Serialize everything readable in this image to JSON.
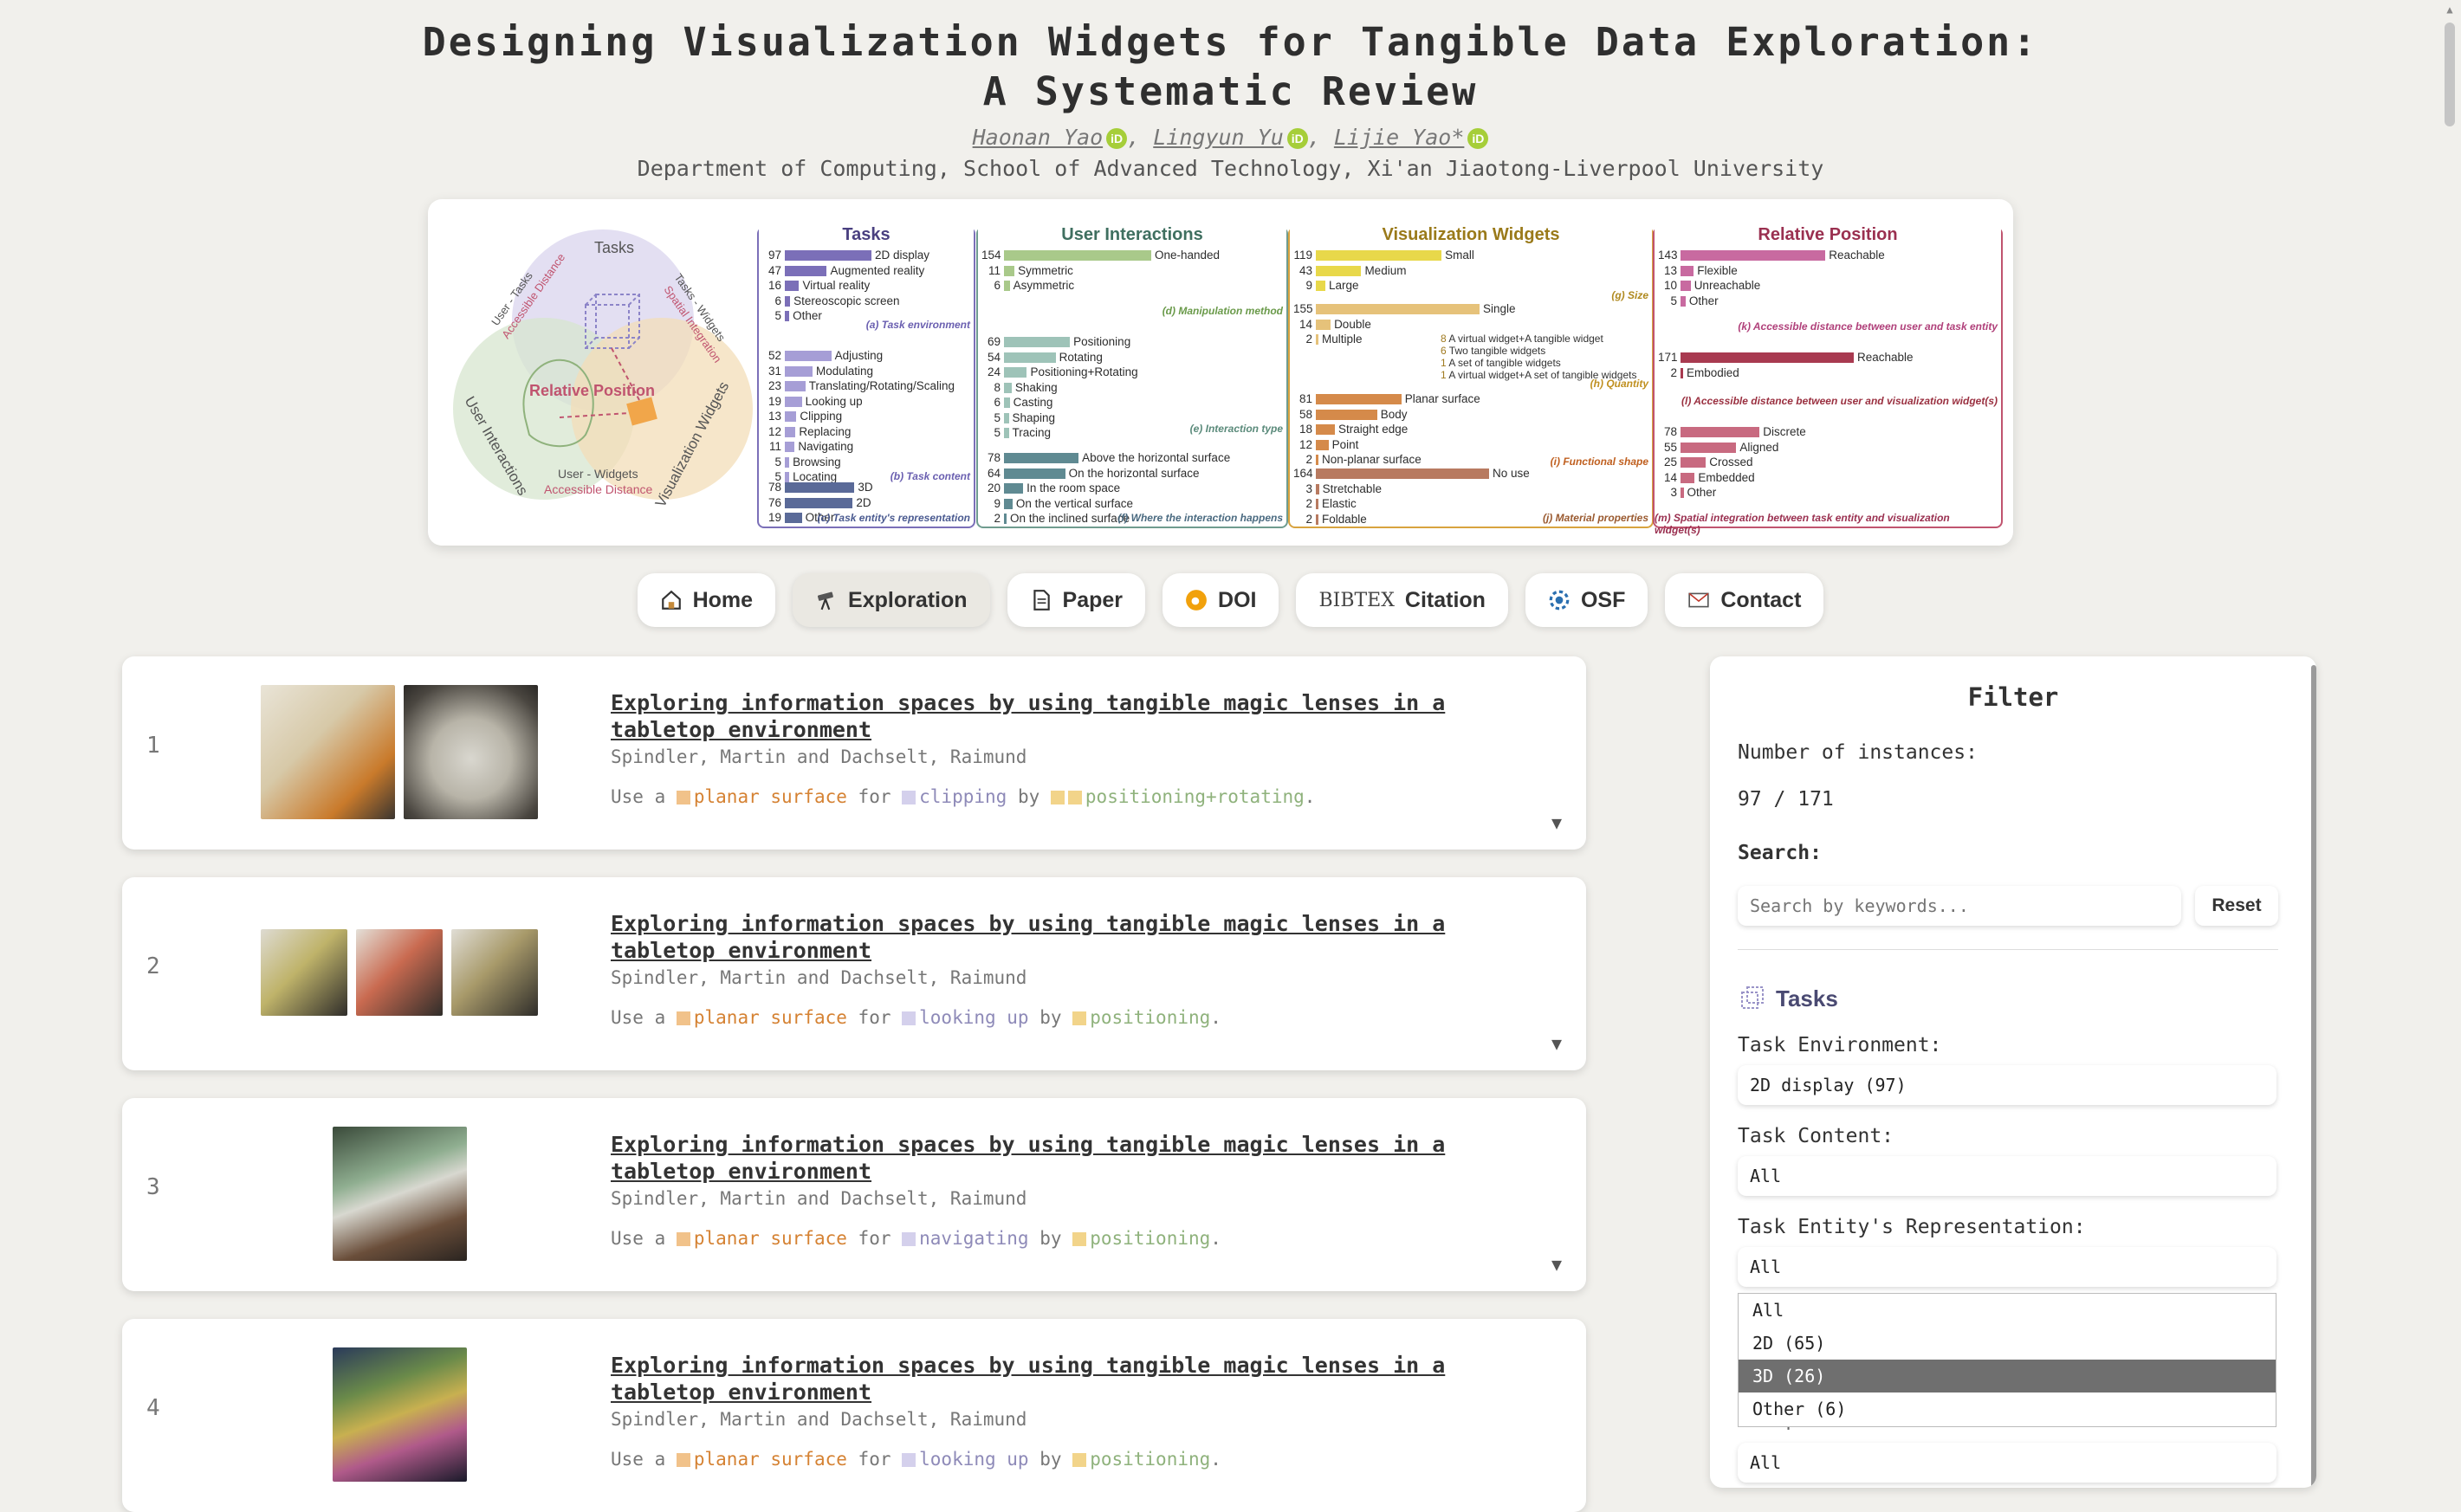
{
  "header": {
    "title_line1": "Designing Visualization Widgets for Tangible Data Exploration:",
    "title_line2": "A Systematic Review",
    "authors": [
      "Haonan Yao",
      "Lingyun Yu",
      "Lijie Yao*"
    ],
    "affiliation": "Department of Computing, School of Advanced Technology, Xi'an Jiaotong-Liverpool University"
  },
  "teaser": {
    "venn": {
      "tasks": "Tasks",
      "relative_position": "Relative Position",
      "user_interactions": "User Interactions",
      "visualization_widgets": "Visualization Widgets",
      "user_tasks": "User - Tasks",
      "user_tasks_sub": "Accessible Distance",
      "tasks_widgets": "Tasks - Widgets",
      "tasks_widgets_sub": "Spatial Integration",
      "user_widgets": "User - Widgets",
      "user_widgets_sub": "Accessible Distance"
    },
    "tasks_panel": {
      "title": "Tasks",
      "env": [
        [
          "97",
          "2D display"
        ],
        [
          "47",
          "Augmented reality"
        ],
        [
          "16",
          "Virtual reality"
        ],
        [
          "6",
          "Stereoscopic screen"
        ],
        [
          "5",
          "Other"
        ]
      ],
      "env_cap": "(a) Task environment",
      "content": [
        [
          "52",
          "Adjusting"
        ],
        [
          "31",
          "Modulating"
        ],
        [
          "23",
          "Translating/Rotating/Scaling"
        ],
        [
          "19",
          "Looking up"
        ],
        [
          "13",
          "Clipping"
        ],
        [
          "12",
          "Replacing"
        ],
        [
          "11",
          "Navigating"
        ],
        [
          "5",
          "Browsing"
        ],
        [
          "5",
          "Locating"
        ]
      ],
      "content_cap": "(b) Task content",
      "repr": [
        [
          "78",
          "3D"
        ],
        [
          "76",
          "2D"
        ],
        [
          "19",
          "Other"
        ]
      ],
      "repr_cap": "(c) Task entity's representation"
    },
    "interactions_panel": {
      "title": "User Interactions",
      "method": [
        [
          "154",
          "One-handed"
        ],
        [
          "11",
          "Symmetric"
        ],
        [
          "6",
          "Asymmetric"
        ]
      ],
      "method_cap": "(d) Manipulation method",
      "type": [
        [
          "69",
          "Positioning"
        ],
        [
          "54",
          "Rotating"
        ],
        [
          "24",
          "Positioning+Rotating"
        ],
        [
          "8",
          "Shaking"
        ],
        [
          "6",
          "Casting"
        ],
        [
          "5",
          "Shaping"
        ],
        [
          "5",
          "Tracing"
        ]
      ],
      "type_cap": "(e) Interaction type",
      "where": [
        [
          "78",
          "Above the horizontal surface"
        ],
        [
          "64",
          "On the horizontal surface"
        ],
        [
          "20",
          "In the room space"
        ],
        [
          "9",
          "On the vertical surface"
        ],
        [
          "2",
          "On the inclined surface"
        ]
      ],
      "where_cap": "(f) Where the interaction happens"
    },
    "widgets_panel": {
      "title": "Visualization Widgets",
      "size": [
        [
          "119",
          "Small"
        ],
        [
          "43",
          "Medium"
        ],
        [
          "9",
          "Large"
        ]
      ],
      "size_cap": "(g) Size",
      "quantity_single": [
        "155",
        "Single"
      ],
      "quantity_double": [
        "14",
        "Double"
      ],
      "quantity_double_items": [
        [
          "8",
          "A virtual widget+A tangible widget"
        ],
        [
          "6",
          "Two tangible widgets"
        ]
      ],
      "quantity_multiple": [
        "2",
        "Multiple"
      ],
      "quantity_multiple_items": [
        [
          "1",
          "A set of tangible widgets"
        ],
        [
          "1",
          "A virtual widget+A set of tangible widgets"
        ]
      ],
      "quantity_cap": "(h) Quantity",
      "shape": [
        [
          "81",
          "Planar surface"
        ],
        [
          "58",
          "Body"
        ],
        [
          "18",
          "Straight edge"
        ],
        [
          "12",
          "Point"
        ],
        [
          "2",
          "Non-planar surface"
        ]
      ],
      "shape_cap": "(i) Functional shape",
      "material": [
        [
          "164",
          "No use"
        ],
        [
          "3",
          "Stretchable"
        ],
        [
          "2",
          "Elastic"
        ],
        [
          "2",
          "Foldable"
        ]
      ],
      "material_cap": "(j) Material properties"
    },
    "position_panel": {
      "title": "Relative Position",
      "task_dist": [
        [
          "143",
          "Reachable"
        ],
        [
          "13",
          "Flexible"
        ],
        [
          "10",
          "Unreachable"
        ],
        [
          "5",
          "Other"
        ]
      ],
      "task_dist_cap": "(k) Accessible distance between user and task entity",
      "widget_dist": [
        [
          "171",
          "Reachable"
        ],
        [
          "2",
          "Embodied"
        ]
      ],
      "widget_dist_cap": "(l) Accessible distance between user and visualization widget(s)",
      "spatial": [
        [
          "78",
          "Discrete"
        ],
        [
          "55",
          "Aligned"
        ],
        [
          "25",
          "Crossed"
        ],
        [
          "14",
          "Embedded"
        ],
        [
          "3",
          "Other"
        ]
      ],
      "spatial_cap": "(m) Spatial integration between task entity and visualization widget(s)"
    }
  },
  "nav": {
    "home": "Home",
    "exploration": "Exploration",
    "paper": "Paper",
    "doi": "DOI",
    "bibtex_logo": "BIBTEX",
    "citation": "Citation",
    "osf": "OSF",
    "contact": "Contact"
  },
  "results": [
    {
      "num": "1",
      "title": "Exploring information spaces by using tangible magic lenses in a tabletop environment",
      "authors": "Spindler, Martin and Dachselt, Raimund",
      "use": "Use a",
      "shape": "planar surface",
      "for": "for",
      "task": "clipping",
      "by": "by",
      "interaction": "positioning+rotating",
      "end": "."
    },
    {
      "num": "2",
      "title": "Exploring information spaces by using tangible magic lenses in a tabletop environment",
      "authors": "Spindler, Martin and Dachselt, Raimund",
      "use": "Use a",
      "shape": "planar surface",
      "for": "for",
      "task": "looking up",
      "by": "by",
      "interaction": "positioning",
      "end": "."
    },
    {
      "num": "3",
      "title": "Exploring information spaces by using tangible magic lenses in a tabletop environment",
      "authors": "Spindler, Martin and Dachselt, Raimund",
      "use": "Use a",
      "shape": "planar surface",
      "for": "for",
      "task": "navigating",
      "by": "by",
      "interaction": "positioning",
      "end": "."
    },
    {
      "num": "4",
      "title": "Exploring information spaces by using tangible magic lenses in a tabletop environment",
      "authors": "Spindler, Martin and Dachselt, Raimund",
      "use": "Use a",
      "shape": "planar surface",
      "for": "for",
      "task": "looking up",
      "by": "by",
      "interaction": "positioning",
      "end": "."
    }
  ],
  "filter": {
    "title": "Filter",
    "instances_label": "Number of instances:",
    "instances_value": "97 / 171",
    "search_label": "Search:",
    "search_placeholder": "Search by keywords...",
    "reset": "Reset",
    "tasks_heading": "Tasks",
    "task_env_label": "Task Environment:",
    "task_env_value": "2D display (97)",
    "task_content_label": "Task Content:",
    "task_content_value": "All",
    "task_repr_label": "Task Entity's Representation:",
    "task_repr_value": "All",
    "dropdown_options": [
      "All",
      "2D (65)",
      "3D (26)",
      "Other (6)"
    ],
    "dropdown_selected": "3D (26)",
    "manip_label_partial": "Manipulation Method:",
    "manip_value": "All"
  },
  "colors": {
    "background": "#f1f0ec",
    "tasks": "#7b6fb8",
    "interactions": "#8fb27c",
    "widgets": "#d8a33f",
    "position": "#c0546f",
    "orange_kw": "#d58233",
    "purple_kw": "#8e8ab8",
    "green_kw": "#8fb27c"
  }
}
